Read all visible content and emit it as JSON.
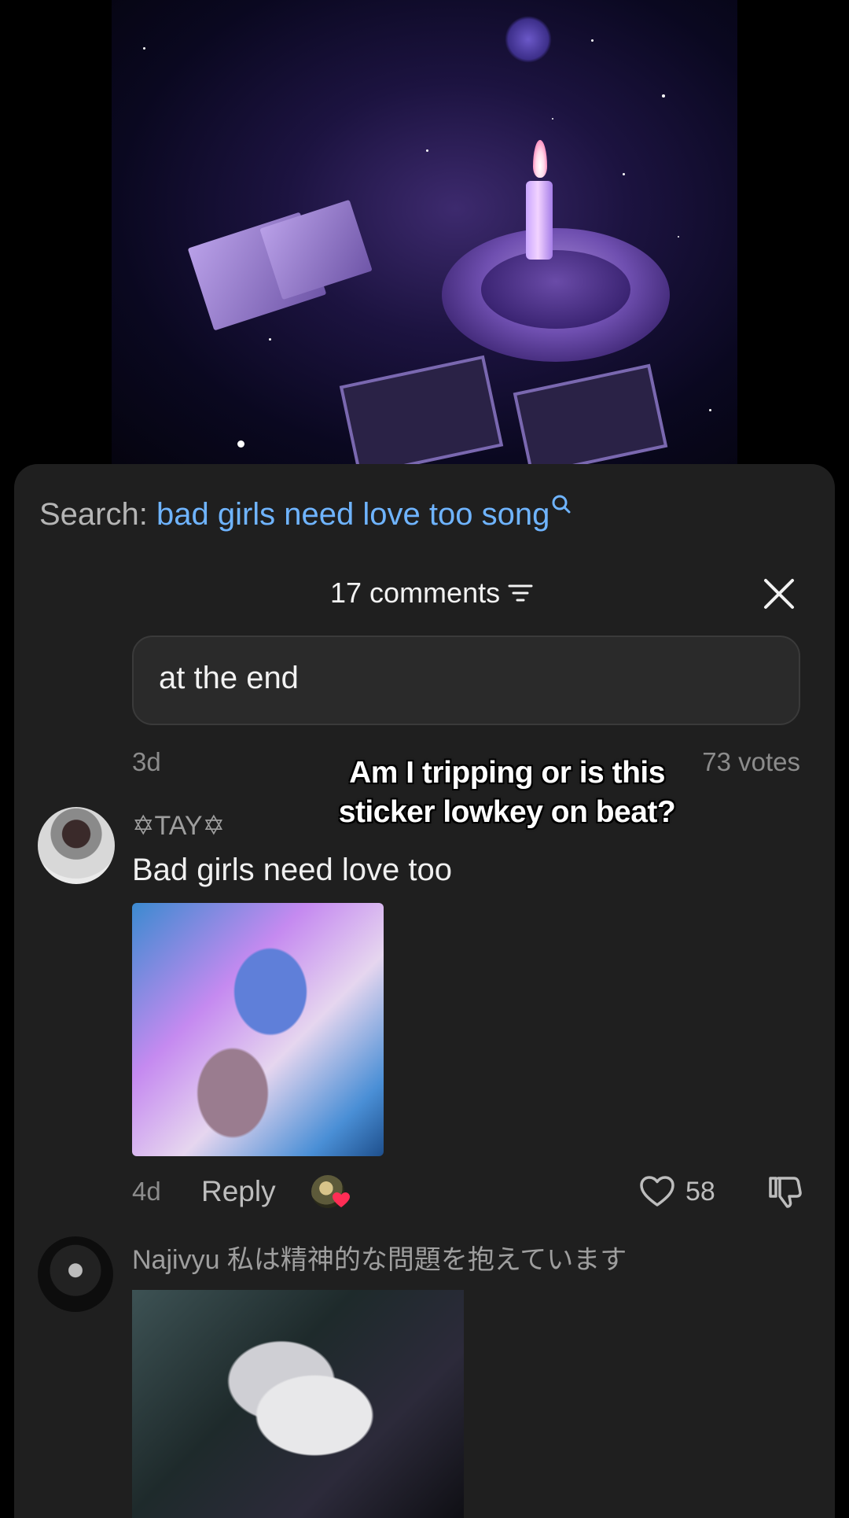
{
  "search": {
    "prefix": "Search: ",
    "term": "bad girls need love too song"
  },
  "comments_panel": {
    "header": "17 comments"
  },
  "pinned": {
    "text": "at the end",
    "age": "3d",
    "votes": "73 votes"
  },
  "sticker_overlay": {
    "text": "Am I tripping or is this sticker lowkey on beat?"
  },
  "comments": [
    {
      "username": "✡TAY✡",
      "text": "Bad girls need love too",
      "age": "4d",
      "reply_label": "Reply",
      "likes": "58"
    },
    {
      "username": "Najivyu 私は精神的な問題を抱えています"
    }
  ],
  "colors": {
    "panel_bg": "#1f1f1f",
    "search_accent": "#6fb4ff",
    "like_heart": "#ff2d55"
  }
}
